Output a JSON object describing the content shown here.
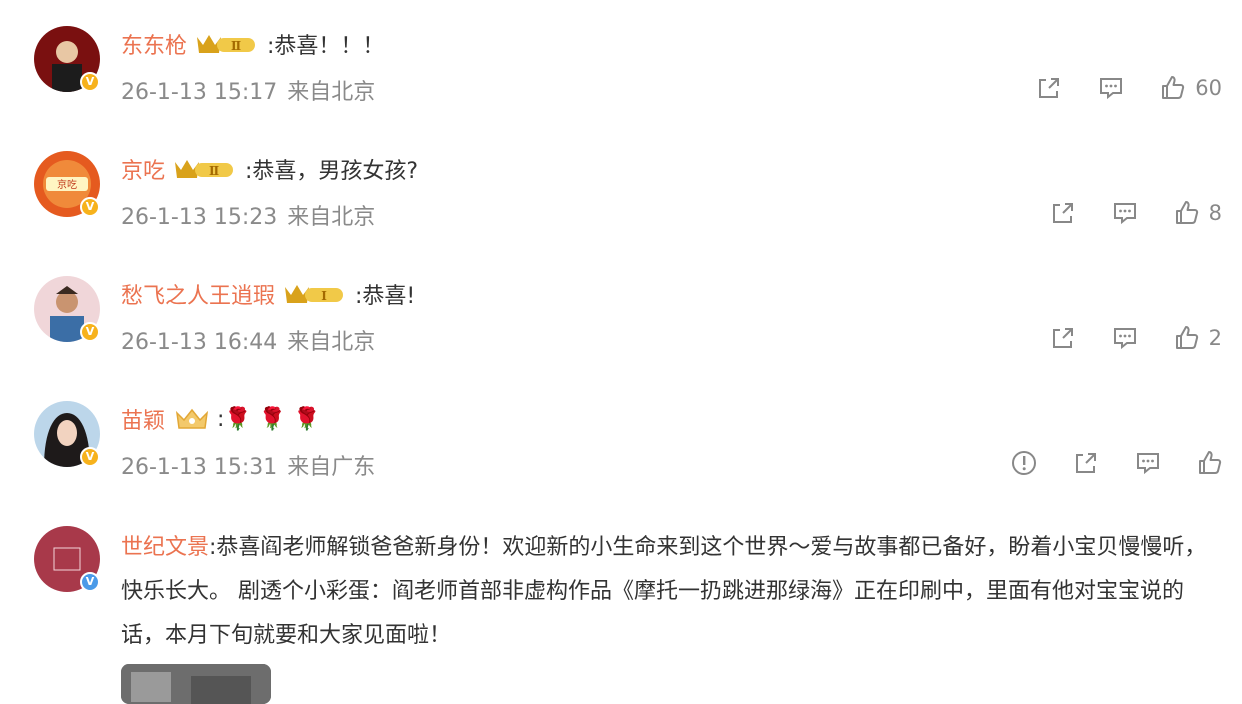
{
  "comments": [
    {
      "username": "东东枪",
      "level_label": "Ⅱ",
      "text": ":恭喜！！！",
      "date": "26-1-13 15:17",
      "location": "来自北京",
      "likes": "60",
      "avatar_badge": "V",
      "avatar_badge_color": "#f7b21c"
    },
    {
      "username": "京吃",
      "level_label": "Ⅱ",
      "text": ":恭喜，男孩女孩?",
      "date": "26-1-13 15:23",
      "location": "来自北京",
      "likes": "8",
      "avatar_badge": "V",
      "avatar_badge_color": "#f7b21c"
    },
    {
      "username": "愁飞之人王逍瑕",
      "level_label": "Ⅰ",
      "text": ":恭喜!",
      "date": "26-1-13 16:44",
      "location": "来自北京",
      "likes": "2",
      "avatar_badge": "V",
      "avatar_badge_color": "#f7b21c"
    },
    {
      "username": "苗颖",
      "text": ":🌹 🌹 🌹",
      "date": "26-1-13 15:31",
      "location": "来自广东",
      "likes": "",
      "avatar_badge": "V",
      "avatar_badge_color": "#f7b21c"
    }
  ],
  "long_comment": {
    "username": "世纪文景",
    "text": ":恭喜阎老师解锁爸爸新身份！欢迎新的小生命来到这个世界～爱与故事都已备好，盼着小宝贝慢慢听，快乐长大。 剧透个小彩蛋：阎老师首部非虚构作品《摩托一扔跳进那绿海》正在印刷中，里面有他对宝宝说的话，本月下旬就要和大家见面啦！",
    "avatar_badge": "V",
    "avatar_badge_color": "#4a9ae8"
  },
  "icons": {
    "share": "share-icon",
    "comment": "comment-icon",
    "like": "like-icon",
    "report": "report-icon"
  },
  "colors": {
    "username": "#eb7350",
    "meta": "#8a8a8a",
    "text": "#333333"
  }
}
